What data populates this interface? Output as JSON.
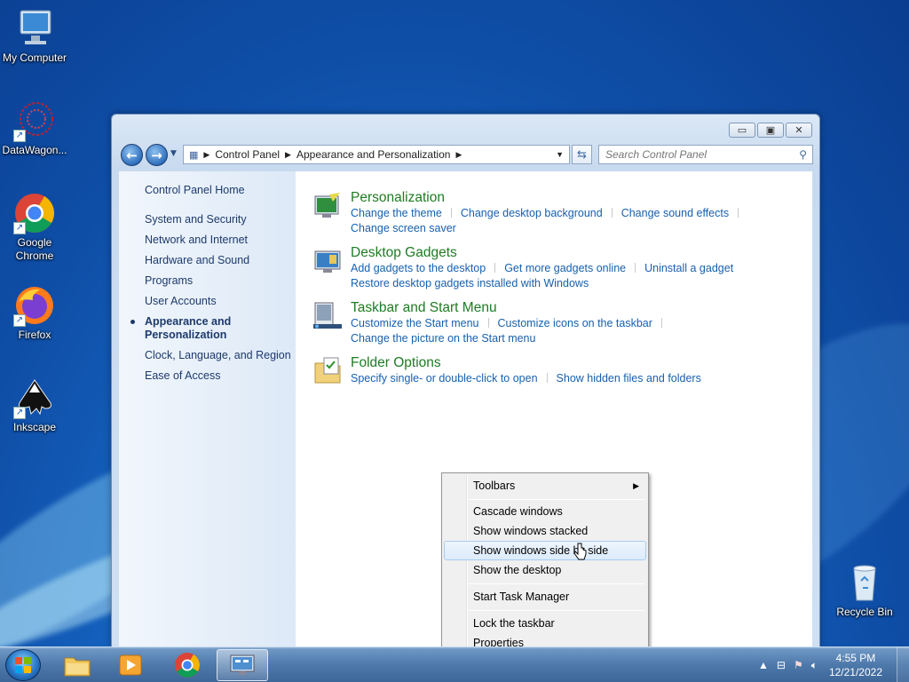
{
  "desktop": {
    "icons": [
      {
        "label": "My Computer"
      },
      {
        "label": "DataWagon..."
      },
      {
        "label": "Google Chrome"
      },
      {
        "label": "Firefox"
      },
      {
        "label": "Inkscape"
      },
      {
        "label": "Recycle Bin"
      }
    ]
  },
  "window": {
    "address": {
      "crumbs": [
        "Control Panel",
        "Appearance and Personalization"
      ]
    },
    "search": {
      "placeholder": "Search Control Panel"
    },
    "buttons": {
      "minimize": "▭",
      "maximize": "▣",
      "close": "✕"
    }
  },
  "sidebar": {
    "home": "Control Panel Home",
    "items": [
      "System and Security",
      "Network and Internet",
      "Hardware and Sound",
      "Programs",
      "User Accounts",
      "Appearance and Personalization",
      "Clock, Language, and Region",
      "Ease of Access"
    ],
    "active_index": 5
  },
  "categories": [
    {
      "title": "Personalization",
      "links": [
        "Change the theme",
        "Change desktop background",
        "Change sound effects",
        "Change screen saver"
      ]
    },
    {
      "title": "Desktop Gadgets",
      "links": [
        "Add gadgets to the desktop",
        "Get more gadgets online",
        "Uninstall a gadget",
        "Restore desktop gadgets installed with Windows"
      ]
    },
    {
      "title": "Taskbar and Start Menu",
      "links": [
        "Customize the Start menu",
        "Customize icons on the taskbar",
        "Change the picture on the Start menu"
      ]
    },
    {
      "title": "Folder Options",
      "links": [
        "Specify single- or double-click to open",
        "Show hidden files and folders"
      ]
    }
  ],
  "context_menu": {
    "items": [
      {
        "label": "Toolbars",
        "submenu": true
      },
      {
        "label": "Cascade windows"
      },
      {
        "label": "Show windows stacked"
      },
      {
        "label": "Show windows side by side",
        "highlighted": true
      },
      {
        "label": "Show the desktop"
      },
      {
        "label": "Start Task Manager"
      },
      {
        "label": "Lock the taskbar"
      },
      {
        "label": "Properties"
      }
    ]
  },
  "taskbar": {
    "clock": {
      "time": "4:55 PM",
      "date": "12/21/2022"
    }
  },
  "colors": {
    "link": "#1760ae",
    "category_title": "#207a24",
    "sidebar_text": "#1d3a6b"
  }
}
